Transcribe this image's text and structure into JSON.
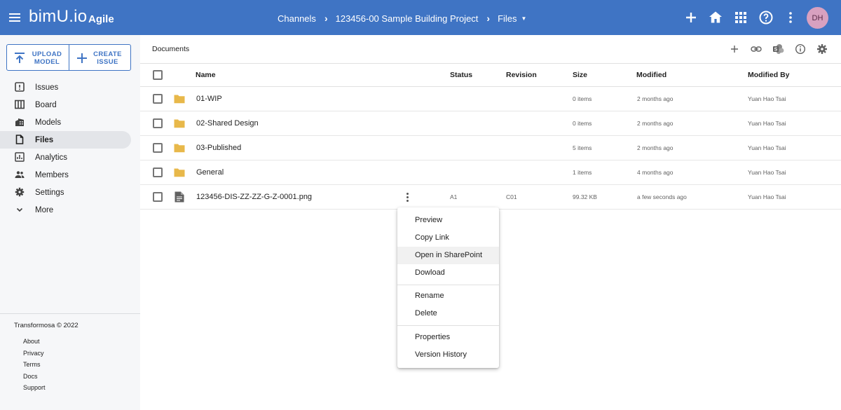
{
  "app": {
    "logo": "bimU.io",
    "product": "Agile",
    "user_initials": "DH"
  },
  "breadcrumb": {
    "items": [
      "Channels",
      "123456-00 Sample Building Project",
      "Files"
    ]
  },
  "sidebar": {
    "upload_label_line1": "UPLOAD",
    "upload_label_line2": "MODEL",
    "create_label_line1": "CREATE",
    "create_label_line2": "ISSUE",
    "items": [
      {
        "label": "Issues",
        "icon": "issues-icon"
      },
      {
        "label": "Board",
        "icon": "board-icon"
      },
      {
        "label": "Models",
        "icon": "models-icon"
      },
      {
        "label": "Files",
        "icon": "files-icon",
        "active": true
      },
      {
        "label": "Analytics",
        "icon": "analytics-icon"
      },
      {
        "label": "Members",
        "icon": "members-icon"
      },
      {
        "label": "Settings",
        "icon": "settings-icon"
      },
      {
        "label": "More",
        "icon": "chevron-down-icon"
      }
    ],
    "copyright": "Transformosa © 2022",
    "footer_links": [
      "About",
      "Privacy",
      "Terms",
      "Docs",
      "Support"
    ]
  },
  "main": {
    "title": "Documents",
    "columns": {
      "name": "Name",
      "status": "Status",
      "revision": "Revision",
      "size": "Size",
      "modified": "Modified",
      "modified_by": "Modified By"
    },
    "rows": [
      {
        "type": "folder",
        "name": "01-WIP",
        "status": "",
        "revision": "",
        "size": "0 items",
        "modified": "2 months ago",
        "modified_by": "Yuan Hao Tsai"
      },
      {
        "type": "folder",
        "name": "02-Shared Design",
        "status": "",
        "revision": "",
        "size": "0 items",
        "modified": "2 months ago",
        "modified_by": "Yuan Hao Tsai"
      },
      {
        "type": "folder",
        "name": "03-Published",
        "status": "",
        "revision": "",
        "size": "5 items",
        "modified": "2 months ago",
        "modified_by": "Yuan Hao Tsai"
      },
      {
        "type": "folder",
        "name": "General",
        "status": "",
        "revision": "",
        "size": "1 items",
        "modified": "4 months ago",
        "modified_by": "Yuan Hao Tsai"
      },
      {
        "type": "file",
        "name": "123456-DIS-ZZ-ZZ-G-Z-0001.png",
        "status": "A1",
        "revision": "C01",
        "size": "99.32 KB",
        "modified": "a few seconds ago",
        "modified_by": "Yuan Hao Tsai"
      }
    ]
  },
  "context_menu": {
    "items": [
      "Preview",
      "Copy Link",
      "Open in SharePoint",
      "Dowload",
      "Rename",
      "Delete",
      "Properties",
      "Version History"
    ],
    "hovered": "Open in SharePoint"
  },
  "colors": {
    "brand": "#3f74c4",
    "folder": "#e8b84a",
    "avatar": "#d8a1c0"
  }
}
